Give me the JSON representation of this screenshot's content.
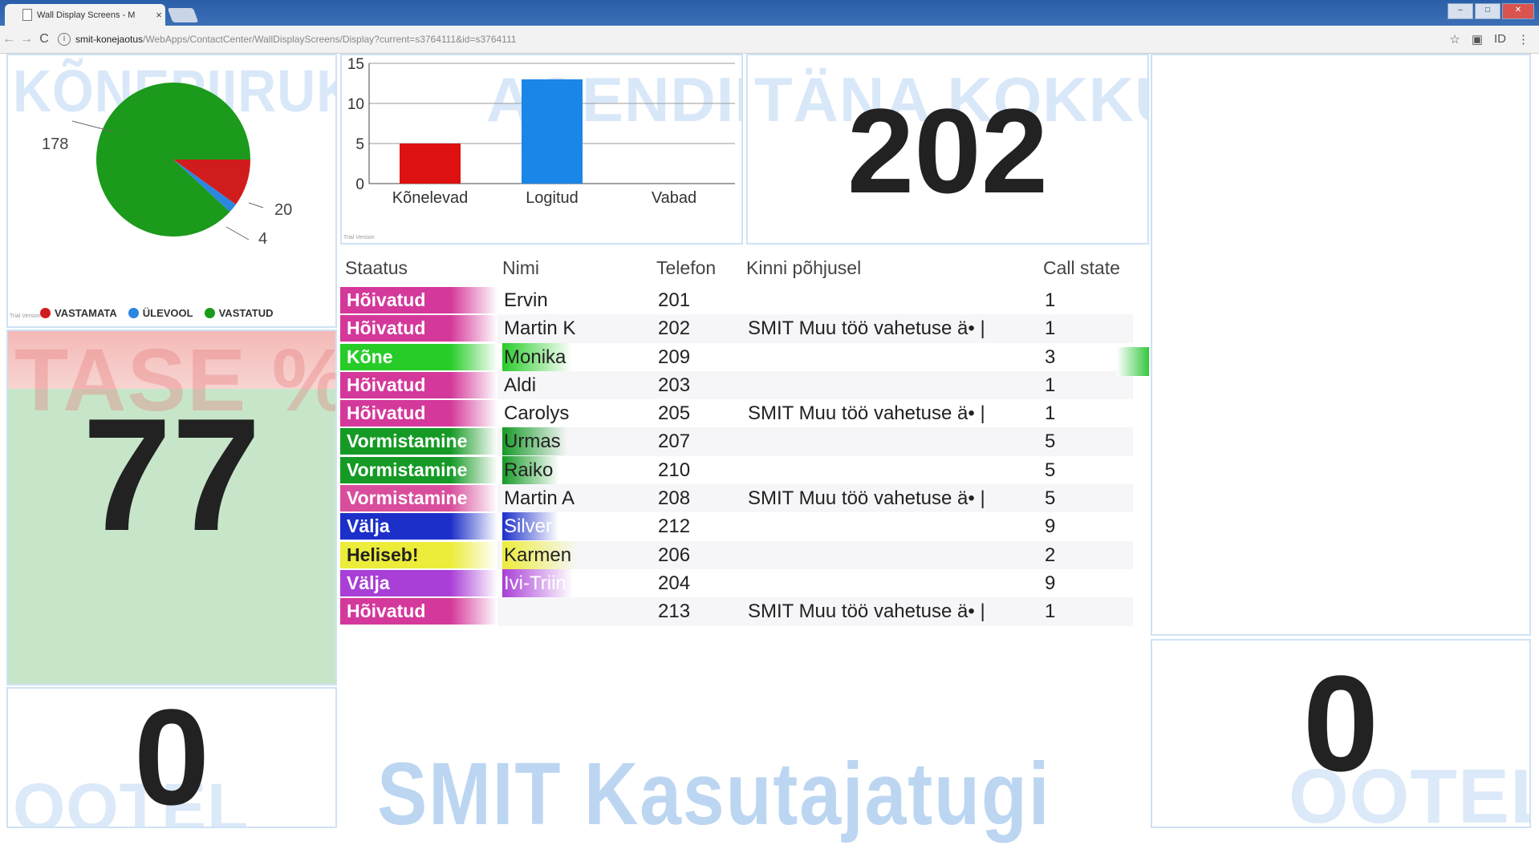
{
  "browser": {
    "tab_title": "Wall Display Screens - M",
    "tab_close": "×",
    "url_host": "smit-konejaotus",
    "url_path": "/WebApps/ContactCenter/WallDisplayScreens/Display?current=s3764111&id=s3764111",
    "back": "←",
    "forward": "→",
    "reload": "C",
    "info": "i",
    "star": "☆",
    "ext1": "▣",
    "ext2": "ID",
    "menu": "⋮"
  },
  "pie_panel": {
    "watermark": "KÕNEPIIRUKAS",
    "trial": "Trial Version",
    "legend": [
      {
        "label": "VASTAMATA",
        "color": "#d01c1c"
      },
      {
        "label": "ÜLEVOOL",
        "color": "#2a86e0"
      },
      {
        "label": "VASTATUD",
        "color": "#1b9a1b"
      }
    ],
    "labels": {
      "vastatud": "178",
      "vastamata": "20",
      "ylevool": "4"
    }
  },
  "chart_data": [
    {
      "type": "pie",
      "title": "",
      "categories": [
        "VASTAMATA",
        "ÜLEVOOL",
        "VASTATUD"
      ],
      "values": [
        20,
        4,
        178
      ],
      "colors": [
        "#d01c1c",
        "#2a86e0",
        "#1b9a1b"
      ],
      "legend": "bottom"
    },
    {
      "type": "bar",
      "title": "",
      "categories": [
        "Kõnelevad",
        "Logitud",
        "Vabad"
      ],
      "values": [
        5,
        13,
        0
      ],
      "colors": [
        "#dd1111",
        "#1a86e8",
        "#888888"
      ],
      "ylim": [
        0,
        15
      ],
      "yticks": [
        0,
        5,
        10,
        15
      ],
      "grid": true
    }
  ],
  "bar_panel": {
    "watermark": "AGENDID",
    "trial": "Trial Version"
  },
  "total_panel": {
    "watermark": "TÄNA KOKKU",
    "value": "202"
  },
  "level_panel": {
    "watermark": "TASE %",
    "value": "77"
  },
  "queue_left": {
    "watermark": "OOTEL",
    "value": "0"
  },
  "queue_right": {
    "watermark": "OOTEL",
    "value": "0"
  },
  "footer_watermark": "SMIT Kasutajatugi",
  "agents_table": {
    "columns": {
      "status": "Staatus",
      "name": "Nimi",
      "phone": "Telefon",
      "reason": "Kinni põhjusel",
      "state": "Call state"
    },
    "rows": [
      {
        "status": "Hõivatud",
        "color": "#d4389a",
        "name": "Ervin",
        "phone": "201",
        "reason": "",
        "state": "1"
      },
      {
        "status": "Hõivatud",
        "color": "#d4389a",
        "name": "Martin K",
        "phone": "202",
        "reason": "SMIT Muu töö vahetuse ä• |",
        "state": "1"
      },
      {
        "status": "Kõne",
        "color": "#28cc28",
        "name": "Monika",
        "phone": "209",
        "reason": "",
        "state": "3"
      },
      {
        "status": "Hõivatud",
        "color": "#d4389a",
        "name": "Aldi",
        "phone": "203",
        "reason": "",
        "state": "1"
      },
      {
        "status": "Hõivatud",
        "color": "#d4389a",
        "name": "Carolys",
        "phone": "205",
        "reason": "SMIT Muu töö vahetuse ä• |",
        "state": "1"
      },
      {
        "status": "Vormistamine",
        "color": "#159a25",
        "name": "Urmas",
        "phone": "207",
        "reason": "",
        "state": "5"
      },
      {
        "status": "Vormistamine",
        "color": "#159a25",
        "name": "Raiko",
        "phone": "210",
        "reason": "",
        "state": "5"
      },
      {
        "status": "Vormistamine",
        "color": "#d94e9c",
        "name": "Martin A",
        "phone": "208",
        "reason": "SMIT Muu töö vahetuse ä• |",
        "state": "5"
      },
      {
        "status": "Välja",
        "color": "#1c2fc9",
        "name": "Silver",
        "phone": "212",
        "reason": "",
        "state": "9"
      },
      {
        "status": "Heliseb!",
        "color": "#ecec3a",
        "name": "Karmen",
        "phone": "206",
        "reason": "",
        "state": "2"
      },
      {
        "status": "Välja",
        "color": "#a93fd6",
        "name": "Ivi-Triin",
        "phone": "204",
        "reason": "",
        "state": "9"
      },
      {
        "status": "Hõivatud",
        "color": "#d4389a",
        "name": "",
        "phone": "213",
        "reason": "SMIT Muu töö vahetuse ä• |",
        "state": "1"
      }
    ]
  }
}
